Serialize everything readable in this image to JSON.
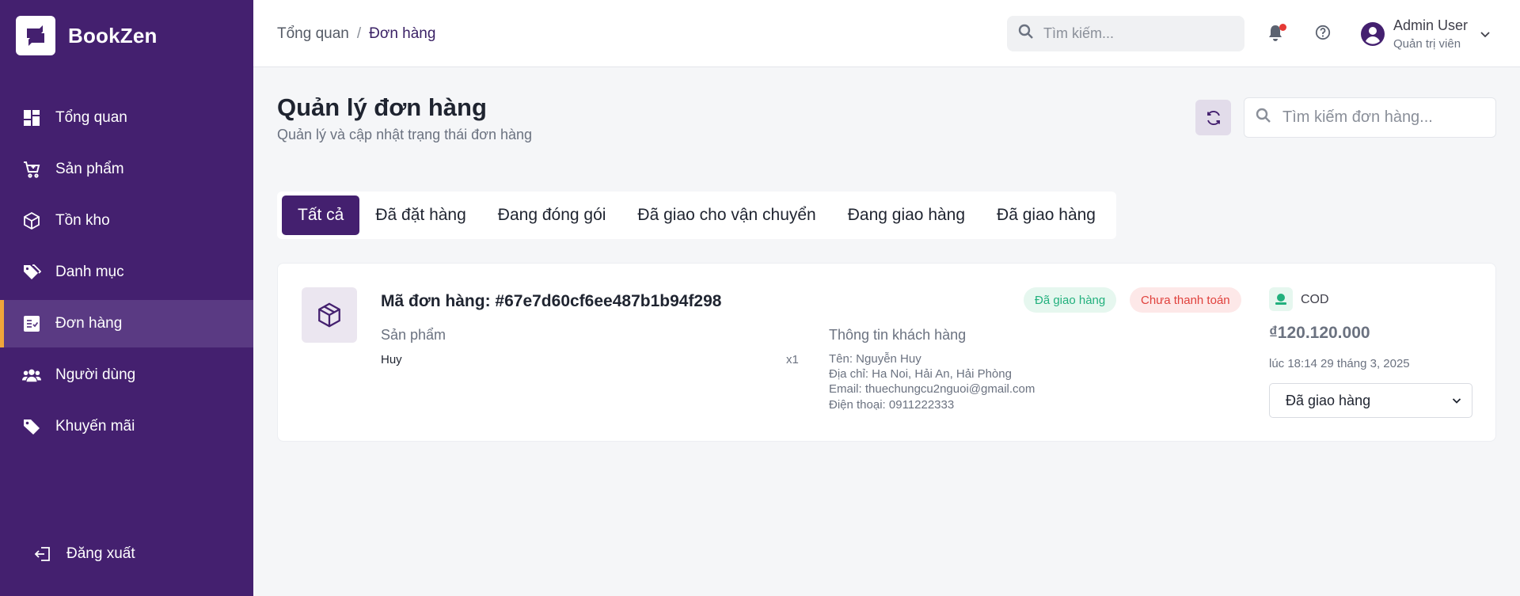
{
  "brand": {
    "name": "BookZen"
  },
  "sidebar": {
    "items": [
      {
        "label": "Tổng quan",
        "icon": "dashboard-icon"
      },
      {
        "label": "Sản phẩm",
        "icon": "cart-icon"
      },
      {
        "label": "Tồn kho",
        "icon": "box-icon"
      },
      {
        "label": "Danh mục",
        "icon": "tags-icon"
      },
      {
        "label": "Đơn hàng",
        "icon": "order-list-icon",
        "active": true
      },
      {
        "label": "Người dùng",
        "icon": "users-icon"
      },
      {
        "label": "Khuyến mãi",
        "icon": "tag-icon"
      }
    ],
    "logout_label": "Đăng xuất"
  },
  "header": {
    "breadcrumb": {
      "home": "Tổng quan",
      "separator": "/",
      "current": "Đơn hàng"
    },
    "search_placeholder": "Tìm kiếm...",
    "user": {
      "name": "Admin User",
      "role": "Quản trị viên"
    }
  },
  "main": {
    "title": "Quản lý đơn hàng",
    "subtitle": "Quản lý và cập nhật trạng thái đơn hàng",
    "search_placeholder": "Tìm kiếm đơn hàng...",
    "tabs": [
      {
        "label": "Tất cả",
        "active": true
      },
      {
        "label": "Đã đặt hàng"
      },
      {
        "label": "Đang đóng gói"
      },
      {
        "label": "Đã giao cho vận chuyển"
      },
      {
        "label": "Đang giao hàng"
      },
      {
        "label": "Đã giao hàng"
      }
    ],
    "order": {
      "id_label": "Mã đơn hàng: #67e7d60cf6ee487b1b94f298",
      "status_badge": "Đã giao hàng",
      "payment_badge": "Chưa thanh toán",
      "products_title": "Sản phẩm",
      "products": [
        {
          "name": "Huy",
          "qty": "x1"
        }
      ],
      "customer_title": "Thông tin khách hàng",
      "customer": {
        "name": "Tên: Nguyễn Huy",
        "address": "Địa chỉ: Ha Noi, Hải An, Hải Phòng",
        "email": "Email: thuechungcu2nguoi@gmail.com",
        "phone": "Điện thoại: 0911222333"
      },
      "payment_method": "COD",
      "amount": "₫120.120.000",
      "time": "lúc 18:14 29 tháng 3, 2025",
      "status_select": "Đã giao hàng"
    }
  },
  "colors": {
    "sidebar_bg": "#44206f",
    "accent": "#f0a53a",
    "success": "#22b07d",
    "danger": "#e0413c"
  }
}
